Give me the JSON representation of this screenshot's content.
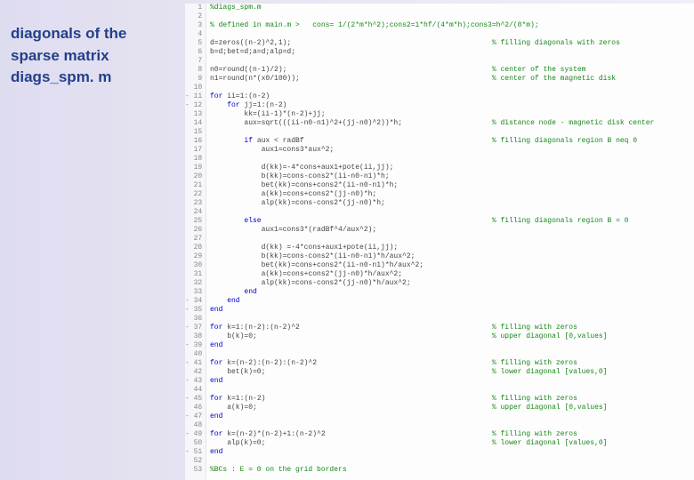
{
  "title": {
    "line1": "diagonals of the",
    "line2": "sparse matrix",
    "line3": "diags_spm. m"
  },
  "code": {
    "lines": [
      {
        "n": 1,
        "text": "%diags_spm.m",
        "comment_all": true
      },
      {
        "n": 2,
        "text": ""
      },
      {
        "n": 3,
        "text": "% defined in main.m >   cons= 1/(2*m*h^2);cons2=1*hf/(4*m*h);cons3=h^2/(8*m);",
        "comment_all": true
      },
      {
        "n": 4,
        "text": ""
      },
      {
        "n": 5,
        "code": "d=zeros((n-2)^2,1);",
        "comment": "% filling diagonals with zeros"
      },
      {
        "n": 6,
        "code": "b=d;bet=d;a=d;alp=d;"
      },
      {
        "n": 7,
        "text": ""
      },
      {
        "n": 8,
        "code": "n0=round((n-1)/2);",
        "comment": "% center of the system"
      },
      {
        "n": 9,
        "code": "n1=round(n*(x0/100));",
        "comment": "% center of the magnetic disk"
      },
      {
        "n": 10,
        "text": ""
      },
      {
        "n": 11,
        "fold": true,
        "code_kw": "for",
        "code_rest": " ii=1:(n-2)"
      },
      {
        "n": 12,
        "fold": true,
        "code_kw": "for",
        "code_rest": " jj=1:(n-2)",
        "indent": 1
      },
      {
        "n": 13,
        "code": "kk=(ii-1)*(n-2)+jj;",
        "indent": 2
      },
      {
        "n": 14,
        "code": "aux=sqrt(((ii-n0-n1)^2+(jj-n0)^2))*h;",
        "indent": 2,
        "comment": "% distance node - magnetic disk center"
      },
      {
        "n": 15,
        "text": ""
      },
      {
        "n": 16,
        "code_kw": "if",
        "code_rest": " aux < radBf",
        "indent": 2,
        "comment": "% filling diagonals region B neq 0"
      },
      {
        "n": 17,
        "code": "aux1=cons3*aux^2;",
        "indent": 3
      },
      {
        "n": 18,
        "text": ""
      },
      {
        "n": 19,
        "code": "d(kk)=-4*cons+aux1+pote(ii,jj);",
        "indent": 3
      },
      {
        "n": 20,
        "code": "b(kk)=cons-cons2*(ii-n0-n1)*h;",
        "indent": 3
      },
      {
        "n": 21,
        "code": "bet(kk)=cons+cons2*(ii-n0-n1)*h;",
        "indent": 3
      },
      {
        "n": 22,
        "code": "a(kk)=cons+cons2*(jj-n0)*h;",
        "indent": 3
      },
      {
        "n": 23,
        "code": "alp(kk)=cons-cons2*(jj-n0)*h;",
        "indent": 3
      },
      {
        "n": 24,
        "text": ""
      },
      {
        "n": 25,
        "code_kw": "else",
        "code_rest": "",
        "indent": 2,
        "comment": "% filling diagonals region B = 0"
      },
      {
        "n": 26,
        "code": "aux1=cons3*(radBf^4/aux^2);",
        "indent": 3
      },
      {
        "n": 27,
        "text": ""
      },
      {
        "n": 28,
        "code": "d(kk) =-4*cons+aux1+pote(ii,jj);",
        "indent": 3
      },
      {
        "n": 29,
        "code": "b(kk)=cons-cons2*(ii-n0-n1)*h/aux^2;",
        "indent": 3
      },
      {
        "n": 30,
        "code": "bet(kk)=cons+cons2*(ii-n0-n1)*h/aux^2;",
        "indent": 3
      },
      {
        "n": 31,
        "code": "a(kk)=cons+cons2*(jj-n0)*h/aux^2;",
        "indent": 3
      },
      {
        "n": 32,
        "code": "alp(kk)=cons-cons2*(jj-n0)*h/aux^2;",
        "indent": 3
      },
      {
        "n": 33,
        "code_kw": "end",
        "indent": 2
      },
      {
        "n": 34,
        "code_kw": "end",
        "indent": 1,
        "fold_end": true
      },
      {
        "n": 35,
        "code_kw": "end",
        "fold_end": true
      },
      {
        "n": 36,
        "text": ""
      },
      {
        "n": 37,
        "fold": true,
        "code_kw": "for",
        "code_rest": " k=1:(n-2):(n-2)^2",
        "comment": "% filling with zeros"
      },
      {
        "n": 38,
        "code": "b(k)=0;",
        "indent": 1,
        "comment": "% upper diagonal [0,values]"
      },
      {
        "n": 39,
        "code_kw": "end",
        "fold_end": true
      },
      {
        "n": 40,
        "text": ""
      },
      {
        "n": 41,
        "fold": true,
        "code_kw": "for",
        "code_rest": " k=(n-2):(n-2):(n-2)^2",
        "comment": "% filling with zeros"
      },
      {
        "n": 42,
        "code": "bet(k)=0;",
        "indent": 1,
        "comment": "% lower diagonal [values,0]"
      },
      {
        "n": 43,
        "code_kw": "end",
        "fold_end": true
      },
      {
        "n": 44,
        "text": ""
      },
      {
        "n": 45,
        "fold": true,
        "code_kw": "for",
        "code_rest": " k=1:(n-2)",
        "comment": "% filling with zeros"
      },
      {
        "n": 46,
        "code": "a(k)=0;",
        "indent": 1,
        "comment": "% upper diagonal [0,values]"
      },
      {
        "n": 47,
        "code_kw": "end",
        "fold_end": true
      },
      {
        "n": 48,
        "text": ""
      },
      {
        "n": 49,
        "fold": true,
        "code_kw": "for",
        "code_rest": " k=(n-2)*(n-2)+1:(n-2)^2",
        "comment": "% filling with zeros"
      },
      {
        "n": 50,
        "code": "alp(k)=0;",
        "indent": 1,
        "comment": "% lower diagonal [values,0]"
      },
      {
        "n": 51,
        "code_kw": "end",
        "fold_end": true
      },
      {
        "n": 52,
        "text": ""
      },
      {
        "n": 53,
        "text": "%BCs : E = 0 on the grid borders",
        "comment_all": true
      }
    ],
    "comment_column": 66
  }
}
